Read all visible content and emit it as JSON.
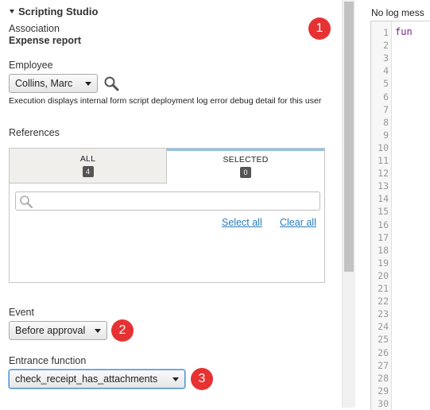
{
  "panel": {
    "title": "Scripting Studio",
    "association_label": "Association",
    "association_value": "Expense report",
    "employee_label": "Employee",
    "employee_value": "Collins, Marc",
    "note": "Execution displays internal form script deployment log error debug detail for this user",
    "references_label": "References",
    "tabs": [
      {
        "label": "ALL",
        "count": "4"
      },
      {
        "label": "SELECTED",
        "count": "0"
      }
    ],
    "search_value": "",
    "select_all": "Select all",
    "clear_all": "Clear all",
    "event_label": "Event",
    "event_value": "Before approval",
    "entrance_label": "Entrance function",
    "entrance_value": "check_receipt_has_attachments"
  },
  "badges": [
    "1",
    "2",
    "3"
  ],
  "log": {
    "message": "No log mess",
    "code_first_line": "fun",
    "line_numbers": [
      "1",
      "2",
      "3",
      "4",
      "5",
      "6",
      "7",
      "8",
      "9",
      "10",
      "11",
      "12",
      "13",
      "14",
      "15",
      "16",
      "17",
      "18",
      "19",
      "20",
      "21",
      "22",
      "23",
      "24",
      "25",
      "26",
      "27",
      "28",
      "29",
      "30"
    ]
  },
  "colors": {
    "badge": "#e63232",
    "link": "#2a7cb8",
    "focus": "#4d90d6",
    "tab_accent": "#8fc4e3"
  }
}
